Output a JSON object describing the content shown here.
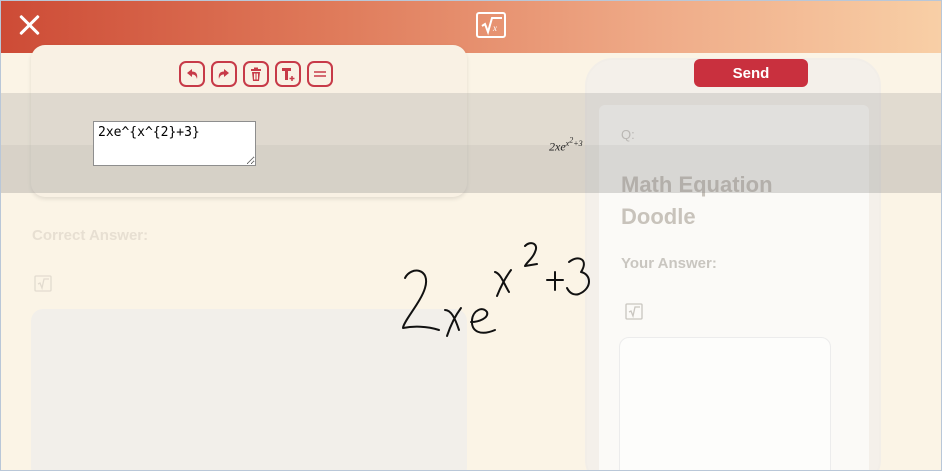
{
  "header": {
    "close_icon": "close-icon",
    "app_icon": "square-root-icon"
  },
  "toolbar": {
    "buttons": [
      "undo-icon",
      "redo-icon",
      "trash-icon",
      "text-insert-icon",
      "equals-icon"
    ]
  },
  "equation": {
    "latex_value": "2xe^{x^{2}+3}",
    "rendered_base": "2xe",
    "rendered_exp1": "x",
    "rendered_exp2": "2",
    "rendered_exp3": "+3"
  },
  "left": {
    "correct_answer_label": "Correct Answer:"
  },
  "preview": {
    "send_label": "Send",
    "q_label": "Q:",
    "question_title": "Math Equation Doodle",
    "your_answer_label": "Your Answer:"
  },
  "colors": {
    "accent": "#c9303e",
    "header_start": "#cd4b36",
    "header_end": "#f8cfa6"
  }
}
